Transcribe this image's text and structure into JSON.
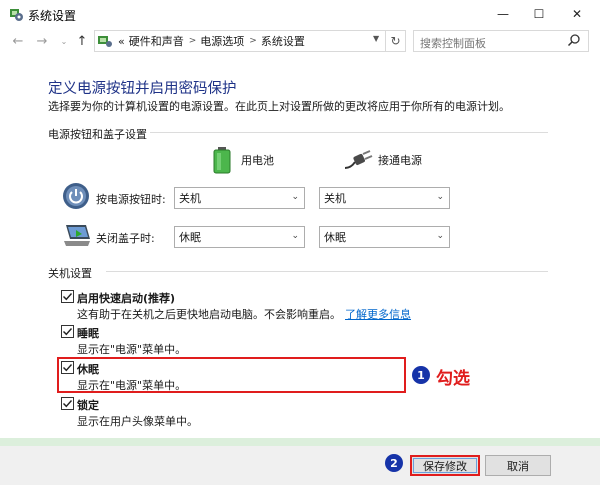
{
  "window": {
    "title": "系统设置",
    "minimize_glyph": "—",
    "maximize_glyph": "☐",
    "close_glyph": "✕"
  },
  "addressbar": {
    "prefix": "«",
    "breadcrumbs": [
      "硬件和声音",
      "电源选项",
      "系统设置"
    ],
    "search_placeholder": "搜索控制面板"
  },
  "page": {
    "heading": "定义电源按钮并启用密码保护",
    "subtitle": "选择要为你的计算机设置的电源设置。在此页上对设置所做的更改将应用于你所有的电源计划。"
  },
  "power_section": {
    "label": "电源按钮和盖子设置",
    "col_battery": "用电池",
    "col_plugged": "接通电源",
    "rows": [
      {
        "label": "按电源按钮时:",
        "battery": "关机",
        "plugged": "关机"
      },
      {
        "label": "关闭盖子时:",
        "battery": "休眠",
        "plugged": "休眠"
      }
    ]
  },
  "shutdown_section": {
    "label": "关机设置",
    "items": [
      {
        "label": "启用快速启动(推荐)",
        "desc": "这有助于在关机之后更快地启动电脑。不会影响重启。",
        "link": "了解更多信息",
        "checked": true
      },
      {
        "label": "睡眠",
        "desc": "显示在\"电源\"菜单中。",
        "checked": true
      },
      {
        "label": "休眠",
        "desc": "显示在\"电源\"菜单中。",
        "checked": true
      },
      {
        "label": "锁定",
        "desc": "显示在用户头像菜单中。",
        "checked": true
      }
    ]
  },
  "annotation": {
    "badge1": "1",
    "badge1_text": "勾选",
    "badge2": "2",
    "highlight_color": "#e01d1d",
    "badge_color": "#1633a8"
  },
  "footer": {
    "save_label": "保存修改",
    "cancel_label": "取消"
  }
}
